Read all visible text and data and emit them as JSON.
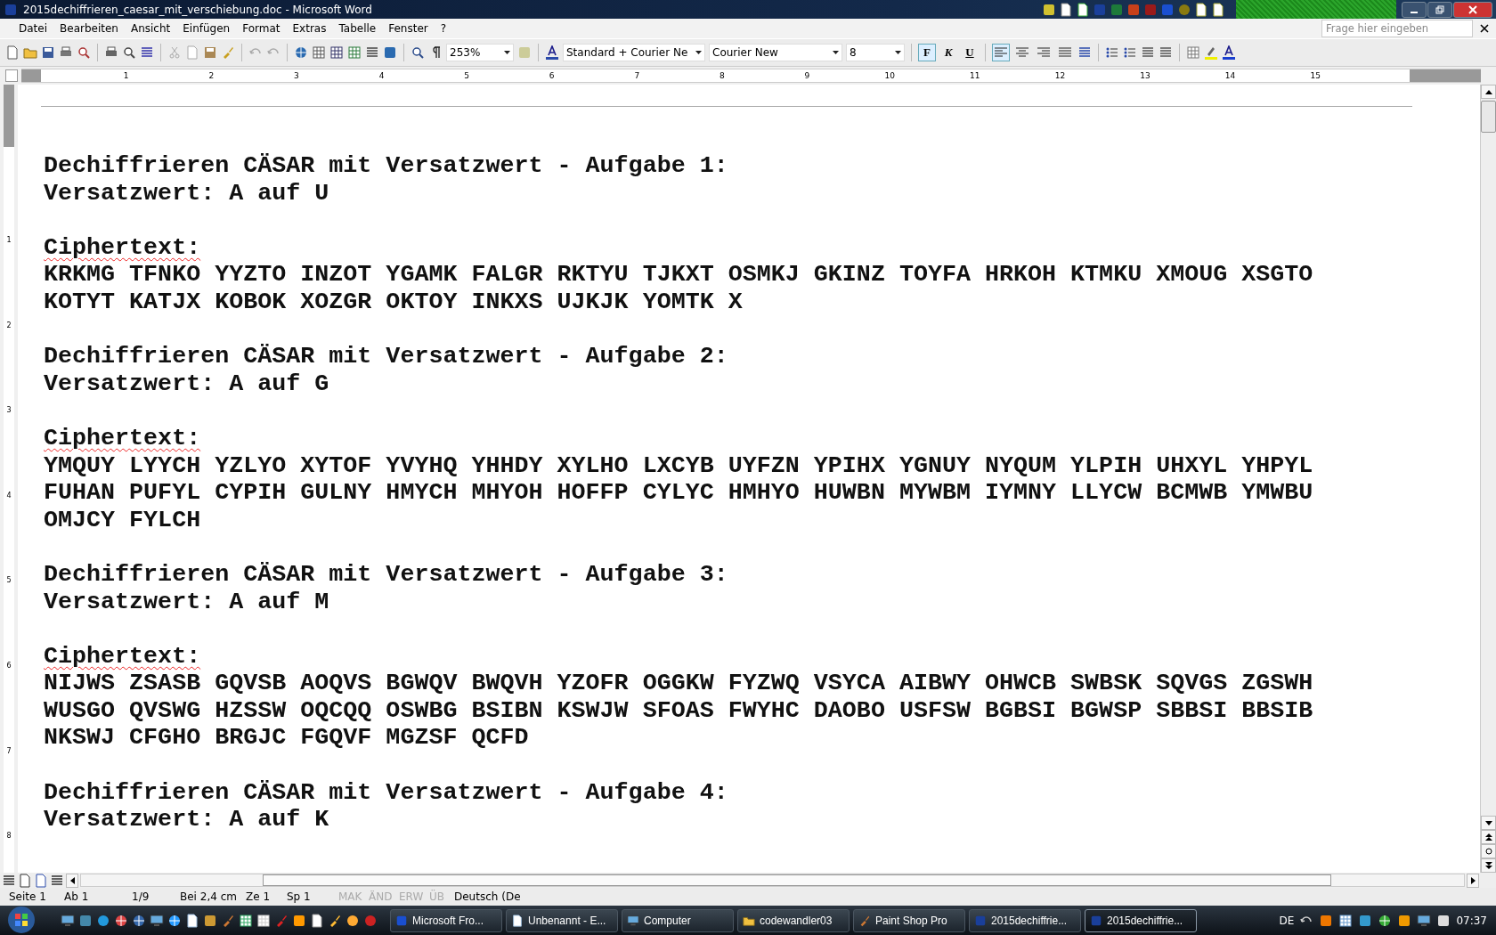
{
  "window": {
    "title": "2015dechiffrieren_caesar_mit_verschiebung.doc - Microsoft Word"
  },
  "menu": [
    "Datei",
    "Bearbeiten",
    "Ansicht",
    "Einfügen",
    "Format",
    "Extras",
    "Tabelle",
    "Fenster",
    "?"
  ],
  "help_box": {
    "placeholder": "Frage hier eingeben"
  },
  "toolbar": {
    "zoom": "253%",
    "style": "Standard + Courier Ne",
    "font": "Courier New",
    "size": "8",
    "format_buttons": [
      {
        "label": "F",
        "selected": true
      },
      {
        "label": "K",
        "selected": false
      },
      {
        "label": "U",
        "selected": false
      }
    ],
    "align_buttons": [
      {
        "selected": true
      },
      {
        "selected": false
      },
      {
        "selected": false
      },
      {
        "selected": false
      }
    ]
  },
  "ruler": {
    "marks": [
      "1",
      "2",
      "3",
      "4",
      "5",
      "6",
      "7",
      "8",
      "9",
      "10",
      "11",
      "12",
      "13",
      "14",
      "15"
    ]
  },
  "vertical_ruler": {
    "marks": [
      "1",
      "2",
      "3",
      "4",
      "5",
      "6",
      "7",
      "8"
    ]
  },
  "document": {
    "sections": [
      {
        "heading": "Dechiffrieren CÄSAR mit Versatzwert - Aufgabe 1:",
        "offset": "Versatzwert: A auf U",
        "cipher_label": {
          "text": "Ciphertext:",
          "misspelled": true
        },
        "lines": [
          "KRKMG TFNKO YYZTO INZOT YGAMK FALGR RKTYU TJKXT OSMKJ GKINZ TOYFA HRKOH KTMKU XMOUG XSGTO",
          "KOTYT KATJX KOBOK XOZGR OKTOY INKXS UJKJK YOMTK X"
        ]
      },
      {
        "heading": "Dechiffrieren CÄSAR mit Versatzwert - Aufgabe 2:",
        "offset": "Versatzwert: A auf G",
        "cipher_label": {
          "text": "Ciphertext:",
          "misspelled": true
        },
        "lines": [
          "YMQUY LYYCH YZLYO XYTOF YVYHQ YHHDY XYLHO LXCYB UYFZN YPIHX YGNUY NYQUM YLPIH UHXYL YHPYL",
          "FUHAN PUFYL CYPIH GULNY HMYCH MHYOH HOFFP CYLYC HMHYO HUWBN MYWBM IYMNY LLYCW BCMWB YMWBU",
          "OMJCY FYLCH"
        ]
      },
      {
        "heading": "Dechiffrieren CÄSAR mit Versatzwert - Aufgabe 3:",
        "offset": "Versatzwert: A auf M",
        "cipher_label": {
          "text": "Ciphertext:",
          "misspelled": true
        },
        "lines": [
          "NIJWS ZSASB GQVSB AOQVS BGWQV BWQVH YZOFR OGGKW FYZWQ VSYCA AIBWY OHWCB SWBSK SQVGS ZGSWH",
          "WUSGO QVSWG HZSSW OQCQQ OSWBG BSIBN KSWJW SFOAS FWYHC DAOBO USFSW BGBSI BGWSP SBBSI BBSIB",
          "NKSWJ CFGHO BRGJC FGQVF MGZSF QCFD"
        ]
      },
      {
        "heading": "Dechiffrieren CÄSAR mit Versatzwert - Aufgabe 4:",
        "offset": "Versatzwert: A auf K"
      }
    ]
  },
  "status_bar": [
    {
      "text": "Seite 1",
      "disabled": false
    },
    {
      "text": "Ab 1",
      "disabled": false
    },
    {
      "text": "1/9",
      "disabled": false
    },
    {
      "text": "Bei 2,4 cm",
      "disabled": false
    },
    {
      "text": "Ze 1",
      "disabled": false
    },
    {
      "text": "Sp 1",
      "disabled": false
    },
    {
      "text": "MAK",
      "disabled": true
    },
    {
      "text": "ÄND",
      "disabled": true
    },
    {
      "text": "ERW",
      "disabled": true
    },
    {
      "text": "ÜB",
      "disabled": true
    },
    {
      "text": "Deutsch (De",
      "disabled": false
    }
  ],
  "taskbar": {
    "windows": [
      {
        "label": "Microsoft Fro...",
        "selected": false
      },
      {
        "label": "Unbenannt - E...",
        "selected": false
      },
      {
        "label": "Computer",
        "selected": false
      },
      {
        "label": "codewandler03",
        "selected": false
      },
      {
        "label": "Paint Shop Pro",
        "selected": false
      },
      {
        "label": "2015dechiffrie...",
        "selected": false
      },
      {
        "label": "2015dechiffrie...",
        "selected": true
      }
    ],
    "language": "DE",
    "clock": "07:37"
  }
}
